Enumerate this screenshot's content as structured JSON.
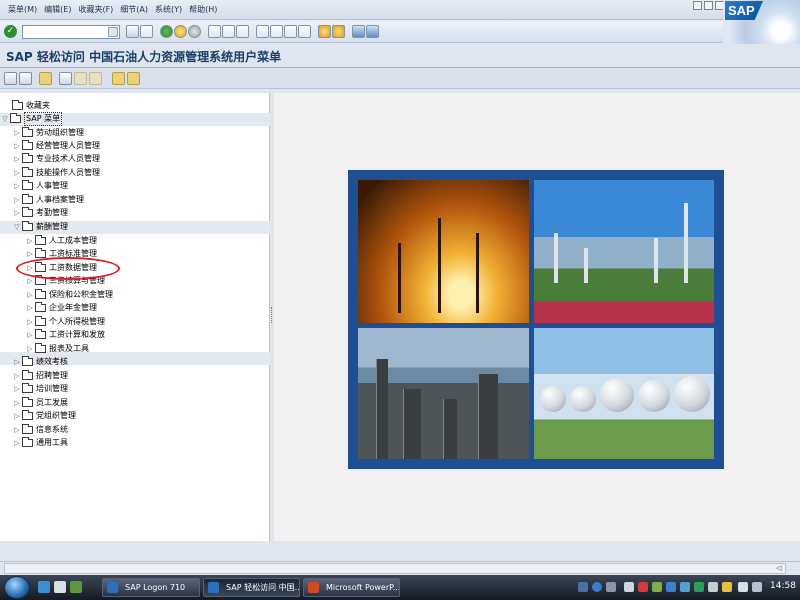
{
  "menubar": {
    "items": [
      "菜单(M)",
      "编辑(E)",
      "收藏夹(F)",
      "细节(A)",
      "系统(Y)",
      "帮助(H)"
    ]
  },
  "logo": {
    "text": "SAP"
  },
  "window_title": "SAP 轻松访问 中国石油人力资源管理系统用户菜单",
  "tree": {
    "favorites": "收藏夹",
    "root": "SAP 菜单",
    "items": [
      "劳动组织管理",
      "经营管理人员管理",
      "专业技术人员管理",
      "技能操作人员管理",
      "人事管理",
      "人事档案管理",
      "考勤管理",
      "薪酬管理"
    ],
    "salary_children": [
      "人工成本管理",
      "工资标准管理",
      "工资数据管理",
      "三资核算与管理",
      "保险和公积金管理",
      "企业年金管理",
      "个人所得税管理",
      "工资计算和发放",
      "报表及工具"
    ],
    "items_after": [
      "绩效考核",
      "招聘管理",
      "培训管理",
      "员工发展",
      "党组织管理",
      "信息系统",
      "通用工具"
    ],
    "highlighted": "工资数据管理"
  },
  "taskbar": {
    "tasks": [
      "SAP Logon 710",
      "SAP 轻松访问 中国...",
      "Microsoft PowerP..."
    ],
    "clock": "14:58"
  },
  "colors": {
    "highlight_ellipse": "#d8202a",
    "title_text": "#1a3f6b",
    "tree_background": "#ffffff",
    "image_frame": "#1f4e93"
  },
  "icons": {
    "enter": "check-circle-icon",
    "folder": "folder-icon",
    "expand": "triangle-right-icon",
    "collapse": "triangle-down-icon"
  }
}
